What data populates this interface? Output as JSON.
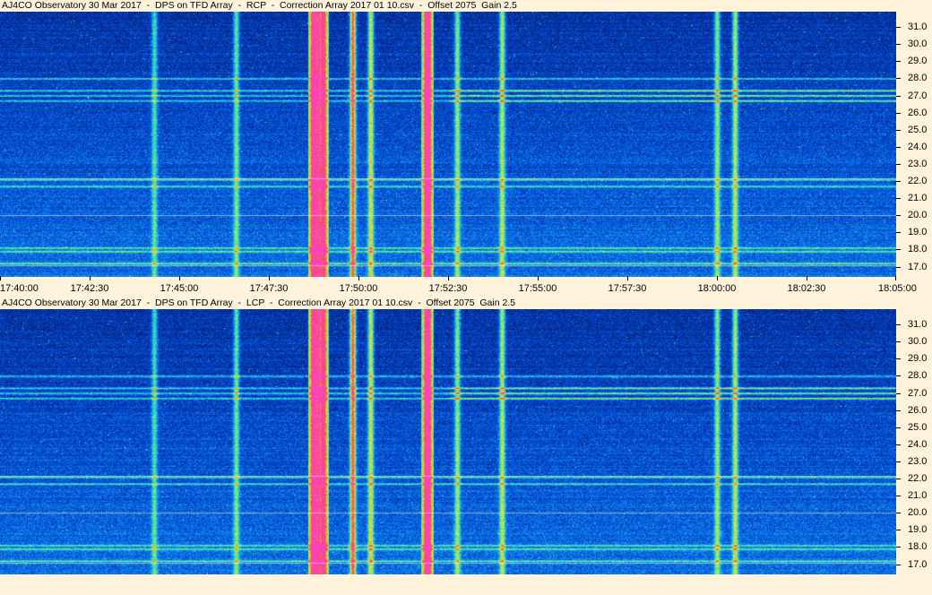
{
  "panels": [
    {
      "title": "AJ4CO Observatory 30 Mar 2017  -  DPS on TFD Array  -  RCP  -  Correction Array 2017 01 10.csv  -  Offset 2075  Gain 2.5"
    },
    {
      "title": "AJ4CO Observatory 30 Mar 2017  -  DPS on TFD Array  -  LCP  -  Correction Array 2017 01 10.csv  -  Offset 2075  Gain 2.5"
    }
  ],
  "chart_data": [
    {
      "type": "heatmap",
      "title": "AJ4CO Observatory 30 Mar 2017  -  DPS on TFD Array  -  RCP  -  Correction Array 2017 01 10.csv  -  Offset 2075  Gain 2.5",
      "polarization": "RCP",
      "xlabel": "",
      "ylabel": "",
      "x_tick_labels": [
        "17:40:00",
        "17:42:30",
        "17:45:00",
        "17:47:30",
        "17:50:00",
        "17:52:30",
        "17:55:00",
        "17:57:30",
        "18:00:00",
        "18:02:30",
        "18:05:00"
      ],
      "y_tick_labels": [
        "17.0",
        "18.0",
        "19.0",
        "20.0",
        "21.0",
        "22.0",
        "23.0",
        "24.0",
        "25.0",
        "26.0",
        "27.0",
        "28.0",
        "29.0",
        "30.0",
        "31.0"
      ],
      "xlim": [
        "17:40:00",
        "18:05:00"
      ],
      "ylim": [
        16.4,
        31.9
      ],
      "colormap": [
        "#0a1e6e",
        "#0040c8",
        "#1080f0",
        "#20c8e0",
        "#60e880",
        "#e0e840",
        "#f0a030",
        "#f05050",
        "#ff40c8"
      ],
      "broadband_bursts": [
        {
          "time": "17:44:18",
          "intensity": 0.35
        },
        {
          "time": "17:46:35",
          "intensity": 0.4
        },
        {
          "time": "17:48:45",
          "intensity": 0.95
        },
        {
          "time": "17:49:00",
          "intensity": 0.9
        },
        {
          "time": "17:49:50",
          "intensity": 0.8
        },
        {
          "time": "17:50:20",
          "intensity": 0.55
        },
        {
          "time": "17:51:55",
          "intensity": 1.0
        },
        {
          "time": "17:52:45",
          "intensity": 0.45
        },
        {
          "time": "17:54:00",
          "intensity": 0.5
        },
        {
          "time": "18:00:00",
          "intensity": 0.45
        },
        {
          "time": "18:00:30",
          "intensity": 0.5
        }
      ],
      "interference_bands": [
        17.2,
        17.9,
        18.1,
        21.7,
        22.1,
        26.7,
        27.0,
        27.3,
        28.0
      ]
    },
    {
      "type": "heatmap",
      "title": "AJ4CO Observatory 30 Mar 2017  -  DPS on TFD Array  -  LCP  -  Correction Array 2017 01 10.csv  -  Offset 2075  Gain 2.5",
      "polarization": "LCP",
      "xlabel": "",
      "ylabel": "",
      "x_tick_labels": [],
      "y_tick_labels": [
        "17.0",
        "18.0",
        "19.0",
        "20.0",
        "21.0",
        "22.0",
        "23.0",
        "24.0",
        "25.0",
        "26.0",
        "27.0",
        "28.0",
        "29.0",
        "30.0",
        "31.0"
      ],
      "xlim": [
        "17:40:00",
        "18:05:00"
      ],
      "ylim": [
        16.4,
        31.9
      ],
      "colormap": [
        "#0a1e6e",
        "#0040c8",
        "#1080f0",
        "#20c8e0",
        "#60e880",
        "#e0e840",
        "#f0a030",
        "#f05050",
        "#ff40c8"
      ],
      "broadband_bursts": [
        {
          "time": "17:44:18",
          "intensity": 0.35
        },
        {
          "time": "17:46:35",
          "intensity": 0.4
        },
        {
          "time": "17:48:45",
          "intensity": 0.95
        },
        {
          "time": "17:49:00",
          "intensity": 0.9
        },
        {
          "time": "17:49:50",
          "intensity": 0.8
        },
        {
          "time": "17:50:20",
          "intensity": 0.55
        },
        {
          "time": "17:51:55",
          "intensity": 1.0
        },
        {
          "time": "17:52:45",
          "intensity": 0.45
        },
        {
          "time": "17:54:00",
          "intensity": 0.5
        },
        {
          "time": "18:00:00",
          "intensity": 0.45
        },
        {
          "time": "18:00:30",
          "intensity": 0.5
        }
      ],
      "interference_bands": [
        17.2,
        17.9,
        18.1,
        21.7,
        22.1,
        26.7,
        27.0,
        27.3,
        28.0
      ]
    }
  ]
}
